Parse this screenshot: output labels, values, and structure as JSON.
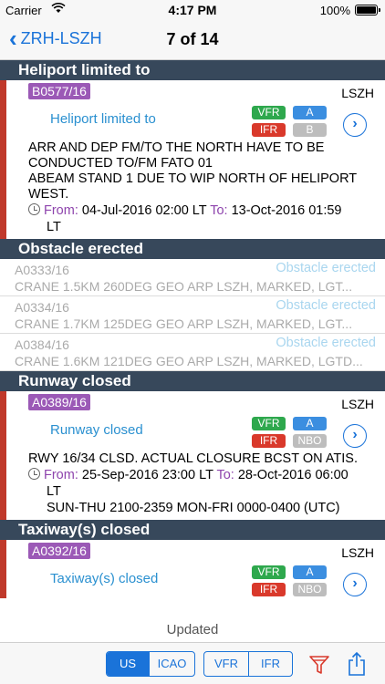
{
  "status_bar": {
    "carrier": "Carrier",
    "time": "4:17 PM",
    "battery_percent": "100%",
    "battery_level": 1.0
  },
  "nav": {
    "back_label": "ZRH-LSZH",
    "title": "7 of 14"
  },
  "sections": {
    "heliport": {
      "header": "Heliport limited to",
      "notam": {
        "id": "B0577/16",
        "location": "LSZH",
        "subject": "Heliport limited to",
        "badge_vfr": "VFR",
        "badge_ifr": "IFR",
        "badge_a": "A",
        "badge_b": "B",
        "body": "ARR AND DEP FM/TO THE NORTH HAVE TO BE CONDUCTED TO/FM FATO 01\nABEAM STAND 1 DUE TO WIP NORTH OF HELIPORT WEST.",
        "from_label": "From:",
        "from": "04-Jul-2016 02:00 LT",
        "to_label": "To:",
        "to": "13-Oct-2016 01:59",
        "to_suffix": "LT"
      }
    },
    "obstacle": {
      "header": "Obstacle erected",
      "rows": [
        {
          "id": "A0333/16",
          "subject": "Obstacle erected",
          "text": "CRANE 1.5KM 260DEG GEO ARP LSZH, MARKED, LGT..."
        },
        {
          "id": "A0334/16",
          "subject": "Obstacle erected",
          "text": "CRANE 1.7KM 125DEG GEO ARP LSZH, MARKED, LGT..."
        },
        {
          "id": "A0384/16",
          "subject": "Obstacle erected",
          "text": "CRANE 1.6KM 121DEG GEO ARP LSZH, MARKED, LGTD..."
        }
      ]
    },
    "runway": {
      "header": "Runway closed",
      "notam": {
        "id": "A0389/16",
        "location": "LSZH",
        "subject": "Runway closed",
        "badge_vfr": "VFR",
        "badge_ifr": "IFR",
        "badge_a": "A",
        "badge_b": "NBO",
        "body": "RWY 16/34 CLSD. ACTUAL CLOSURE BCST ON ATIS.",
        "from_label": "From:",
        "from": "25-Sep-2016 23:00 LT",
        "to_label": "To:",
        "to": "28-Oct-2016 06:00",
        "to_suffix": "LT",
        "schedule": "SUN-THU 2100-2359 MON-FRI 0000-0400 (UTC)"
      }
    },
    "taxiway": {
      "header": "Taxiway(s) closed",
      "notam": {
        "id": "A0392/16",
        "location": "LSZH",
        "subject": "Taxiway(s) closed",
        "badge_vfr": "VFR",
        "badge_ifr": "IFR",
        "badge_a": "A",
        "badge_b": "NBO"
      }
    }
  },
  "updated_label": "Updated",
  "toolbar": {
    "units_us": "US",
    "units_icao": "ICAO",
    "units_selected": "US",
    "rules_vfr": "VFR",
    "rules_ifr": "IFR"
  },
  "colors": {
    "accent": "#1a73d9",
    "header_bg": "#37485b",
    "id_badge": "#9b59b6",
    "vfr": "#2ea84d",
    "ifr": "#d9392b",
    "stripe": "#c0392b"
  }
}
